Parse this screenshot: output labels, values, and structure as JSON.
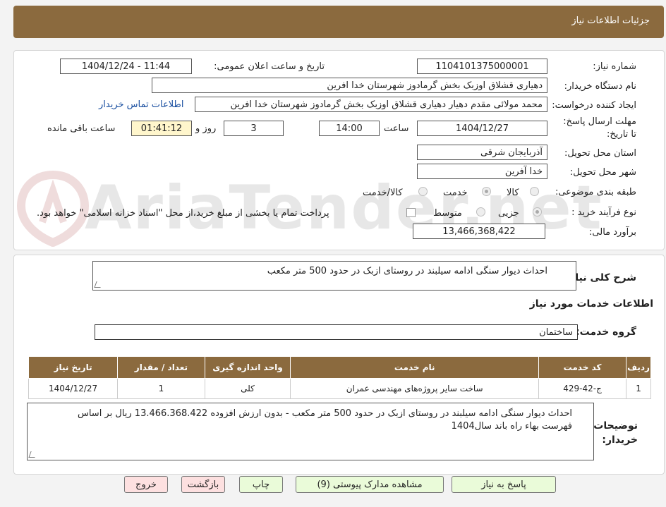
{
  "header": {
    "title": "جزئیات اطلاعات نیاز"
  },
  "form": {
    "need_number_label": "شماره نیاز:",
    "need_number": "1104101375000001",
    "announce_label": "تاریخ و ساعت اعلان عمومی:",
    "announce_value": "1404/12/24 - 11:44",
    "buyer_org_label": "نام دستگاه خریدار:",
    "buyer_org": "دهیاری قشلاق اوزبک بخش گرمادوز شهرستان خدا افرین",
    "creator_label": "ایجاد کننده درخواست:",
    "creator": "محمد مولائی مقدم دهیار دهیاری قشلاق اوزبک بخش گرمادوز شهرستان خدا افرین",
    "contact_link": "اطلاعات تماس خریدار",
    "deadline_label": "مهلت ارسال پاسخ: تا تاریخ:",
    "deadline_date": "1404/12/27",
    "time_label": "ساعت",
    "deadline_time": "14:00",
    "days_value": "3",
    "days_label": "روز و",
    "remaining_time": "01:41:12",
    "remaining_label": "ساعت باقی مانده",
    "province_label": "استان محل تحویل:",
    "province": "آذربایجان شرقی",
    "city_label": "شهر محل تحویل:",
    "city": "خدا آفرین",
    "category_label": "طبقه بندی موضوعی:",
    "category_options": [
      "کالا",
      "خدمت",
      "کالا/خدمت"
    ],
    "process_label": "نوع فرآیند خرید :",
    "process_options": [
      "جزیی",
      "متوسط"
    ],
    "payment_note": "پرداخت تمام یا بخشی از مبلغ خرید،از محل \"اسناد خزانه اسلامی\" خواهد بود.",
    "budget_label": "برآورد مالی:",
    "budget": "13,466,368,422"
  },
  "description": {
    "label": "شرح کلی نیاز:",
    "text": "احداث دیوار سنگی ادامه سیلبند در روستای ازبک  در حدود  500 متر مکعب"
  },
  "services": {
    "section_title": "اطلاعات خدمات مورد نیاز",
    "group_label": "گروه خدمت:",
    "group_value": "ساختمان",
    "columns": [
      "ردیف",
      "کد خدمت",
      "نام خدمت",
      "واحد اندازه گیری",
      "تعداد / مقدار",
      "تاریخ نیاز"
    ],
    "rows": [
      [
        "1",
        "ج-42-429",
        "ساخت سایر پروژه‌های مهندسی عمران",
        "کلی",
        "1",
        "1404/12/27"
      ]
    ]
  },
  "buyer_notes": {
    "label": "توضیحات خریدار:",
    "text": "احداث دیوار سنگی ادامه سیلبند در روستای ازبک  در حدود  500 متر مکعب -  بدون ارزش افزوده 13.466.368.422 ریال بر اساس فهرست بهاء راه باند سال1404"
  },
  "buttons": {
    "reply": "پاسخ به نیاز",
    "attachments": "مشاهده مدارک پیوستی (9)",
    "print": "چاپ",
    "back": "بازگشت",
    "exit": "خروج"
  },
  "watermark": "AriaTender.net",
  "colors": {
    "header": "#8b6a3e",
    "button_green": "#eafbd9",
    "button_red": "#fde0e0",
    "link": "#1a4fa0"
  }
}
